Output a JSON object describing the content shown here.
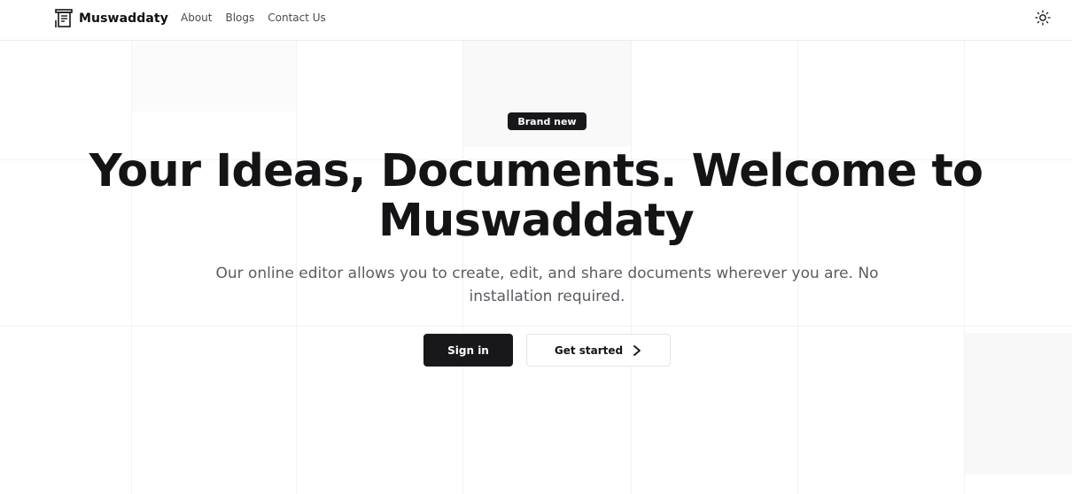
{
  "header": {
    "brand_name": "Muswaddaty",
    "nav": [
      {
        "label": "About"
      },
      {
        "label": "Blogs"
      },
      {
        "label": "Contact Us"
      }
    ],
    "theme_toggle_icon": "sun-icon"
  },
  "hero": {
    "badge": "Brand new",
    "title_line1": "Your Ideas, Documents. Welcome to",
    "title_line2": "Muswaddaty",
    "subtitle": "Our online editor allows you to create, edit, and share documents wherever you are. No installation required.",
    "primary_button": "Sign in",
    "secondary_button": "Get started",
    "secondary_icon": "chevron-right-icon"
  },
  "colors": {
    "dark": "#18181b",
    "muted_text": "#5b5b63",
    "border": "#e3e3e7"
  }
}
